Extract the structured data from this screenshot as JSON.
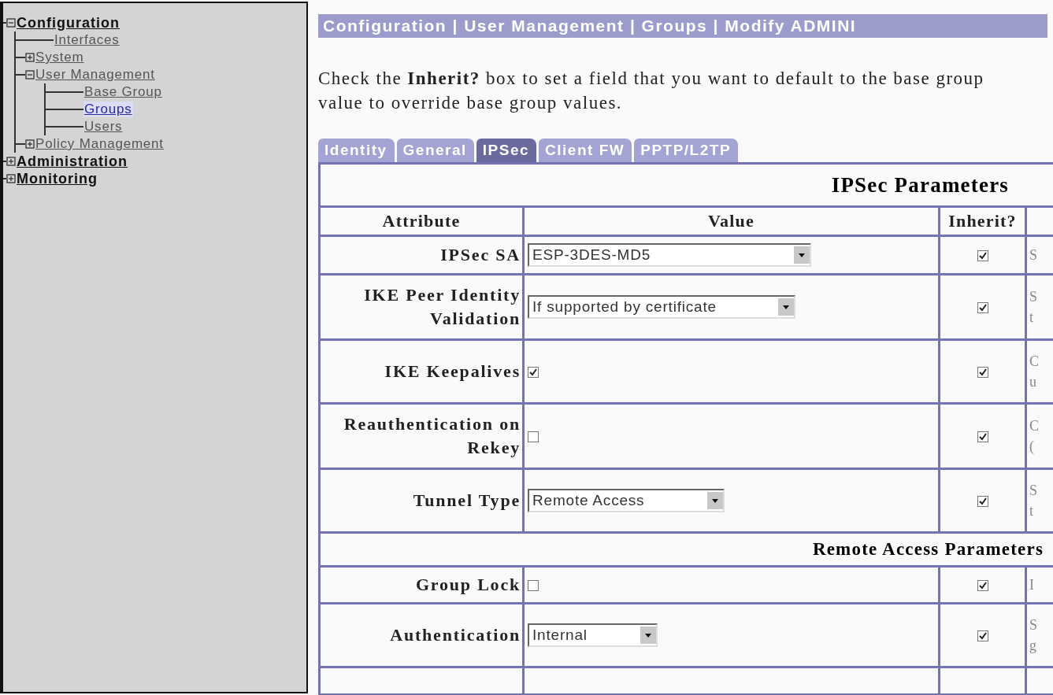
{
  "sidebar": {
    "tree": [
      {
        "label": "Configuration",
        "expanded": true,
        "selected": false,
        "children": [
          {
            "label": "Interfaces",
            "selected": false
          },
          {
            "label": "System",
            "expanded": false,
            "selected": false
          },
          {
            "label": "User Management",
            "expanded": true,
            "selected": false,
            "children": [
              {
                "label": "Base Group",
                "selected": false
              },
              {
                "label": "Groups",
                "selected": true
              },
              {
                "label": "Users",
                "selected": false
              }
            ]
          },
          {
            "label": "Policy Management",
            "expanded": false,
            "selected": false
          }
        ]
      },
      {
        "label": "Administration",
        "expanded": false,
        "selected": false
      },
      {
        "label": "Monitoring",
        "expanded": false,
        "selected": false
      }
    ]
  },
  "breadcrumb": "Configuration | User Management | Groups | Modify ADMINI",
  "instructions": [
    "Check the **Inherit?** box to set a field that you want to default to the base group",
    "value to override base group values."
  ],
  "tabs": [
    {
      "label": "Identity",
      "selected": false
    },
    {
      "label": "General",
      "selected": false
    },
    {
      "label": "IPSec",
      "selected": true
    },
    {
      "label": "Client FW",
      "selected": false
    },
    {
      "label": "PPTP/L2TP",
      "selected": false
    }
  ],
  "table": {
    "title": "IPSec Parameters",
    "columns": [
      "Attribute",
      "Value",
      "Inherit?"
    ],
    "rows": [
      {
        "kind": "select",
        "attribute": "IPSec SA",
        "value": "ESP-3DES-MD5",
        "inherit": true,
        "column_4": [
          "S"
        ]
      },
      {
        "kind": "select",
        "attribute": "IKE Peer Identity Validation",
        "value": "If supported by certificate",
        "inherit": true,
        "column_4": [
          "S",
          "t"
        ]
      },
      {
        "kind": "checkbox",
        "attribute": "IKE Keepalives",
        "checked": true,
        "inherit": true,
        "column_4": [
          "C",
          "u"
        ]
      },
      {
        "kind": "checkbox",
        "attribute": "Reauthentication on Rekey",
        "checked": false,
        "inherit": true,
        "column_4": [
          "C",
          "("
        ]
      },
      {
        "kind": "select",
        "attribute": "Tunnel Type",
        "value": "Remote Access",
        "inherit": true,
        "column_4": [
          "S",
          "t"
        ]
      },
      {
        "kind": "section",
        "title": "Remote Access Parameters"
      },
      {
        "kind": "checkbox",
        "attribute": "Group Lock",
        "checked": false,
        "inherit": true,
        "column_4": [
          "I"
        ]
      },
      {
        "kind": "select",
        "attribute": "Authentication",
        "value": "Internal",
        "inherit": true,
        "column_4": [
          "S",
          "g"
        ]
      }
    ]
  }
}
